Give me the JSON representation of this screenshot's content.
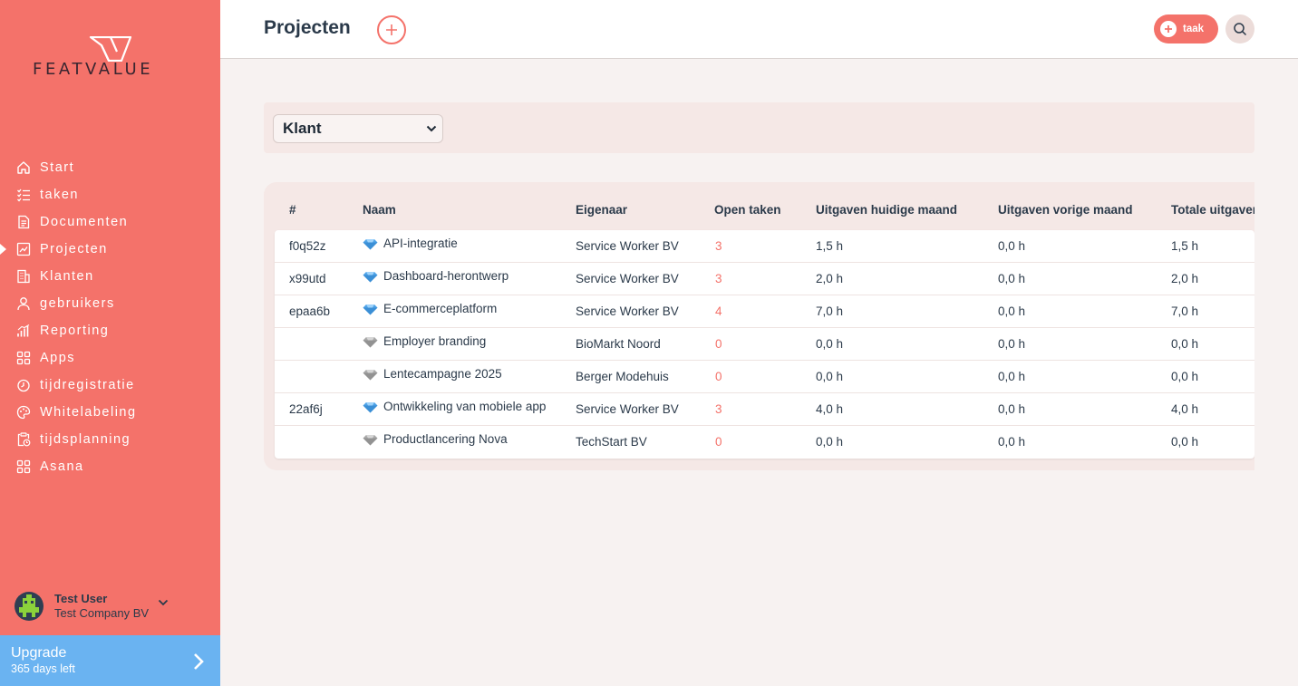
{
  "brand": {
    "name": "FEATVALUE"
  },
  "colors": {
    "accent": "#f4726a",
    "upgrade": "#6ab3f1",
    "text": "#2b3a4a"
  },
  "nav": {
    "items": [
      {
        "label": "Start",
        "icon": "home-icon",
        "active": false
      },
      {
        "label": "taken",
        "icon": "checklist-icon",
        "active": false
      },
      {
        "label": "Documenten",
        "icon": "document-icon",
        "active": false
      },
      {
        "label": "Projecten",
        "icon": "chart-icon",
        "active": true
      },
      {
        "label": "Klanten",
        "icon": "building-icon",
        "active": false
      },
      {
        "label": "gebruikers",
        "icon": "user-icon",
        "active": false
      },
      {
        "label": "Reporting",
        "icon": "bar-chart-icon",
        "active": false
      },
      {
        "label": "Apps",
        "icon": "apps-icon",
        "active": false
      },
      {
        "label": "tijdregistratie",
        "icon": "timer-icon",
        "active": false
      },
      {
        "label": "Whitelabeling",
        "icon": "palette-icon",
        "active": false
      },
      {
        "label": "tijdsplanning",
        "icon": "clipboard-clock-icon",
        "active": false
      },
      {
        "label": "Asana",
        "icon": "apps-icon",
        "active": false
      }
    ]
  },
  "user": {
    "name": "Test User",
    "company": "Test Company BV"
  },
  "upgrade": {
    "title": "Upgrade",
    "subtitle": "365 days left"
  },
  "header": {
    "title": "Projecten",
    "task_button": "taak"
  },
  "filter": {
    "selected": "Klant"
  },
  "table": {
    "headers": [
      "#",
      "Naam",
      "Eigenaar",
      "Open taken",
      "Uitgaven huidige maand",
      "Uitgaven vorige maand",
      "Totale uitgaven"
    ],
    "rows": [
      {
        "id": "f0q52z",
        "name": "API-integratie",
        "gem": "blue",
        "owner": "Service Worker BV",
        "open": "3",
        "current": "1,5 h",
        "previous": "0,0 h",
        "total": "1,5 h"
      },
      {
        "id": "x99utd",
        "name": "Dashboard-herontwerp",
        "gem": "blue",
        "owner": "Service Worker BV",
        "open": "3",
        "current": "2,0 h",
        "previous": "0,0 h",
        "total": "2,0 h"
      },
      {
        "id": "epaa6b",
        "name": "E-commerceplatform",
        "gem": "blue",
        "owner": "Service Worker BV",
        "open": "4",
        "current": "7,0 h",
        "previous": "0,0 h",
        "total": "7,0 h"
      },
      {
        "id": "",
        "name": "Employer branding",
        "gem": "gray",
        "owner": "BioMarkt Noord",
        "open": "0",
        "current": "0,0 h",
        "previous": "0,0 h",
        "total": "0,0 h"
      },
      {
        "id": "",
        "name": "Lentecampagne 2025",
        "gem": "gray",
        "owner": "Berger Modehuis",
        "open": "0",
        "current": "0,0 h",
        "previous": "0,0 h",
        "total": "0,0 h"
      },
      {
        "id": "22af6j",
        "name": "Ontwikkeling van mobiele app",
        "gem": "blue",
        "owner": "Service Worker BV",
        "open": "3",
        "current": "4,0 h",
        "previous": "0,0 h",
        "total": "4,0 h"
      },
      {
        "id": "",
        "name": "Productlancering Nova",
        "gem": "gray",
        "owner": "TechStart BV",
        "open": "0",
        "current": "0,0 h",
        "previous": "0,0 h",
        "total": "0,0 h"
      }
    ]
  }
}
